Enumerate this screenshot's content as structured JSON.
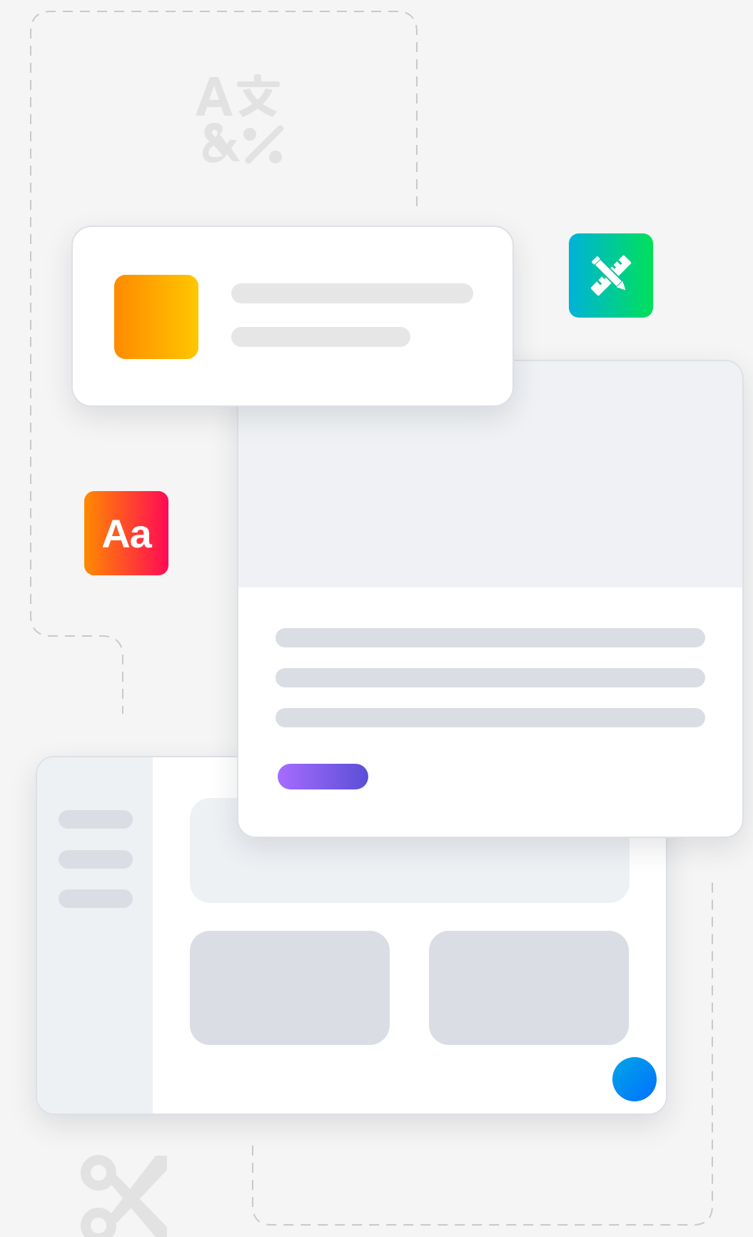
{
  "illustration": {
    "type_icon": {
      "label": "Aa",
      "gradient": [
        "#ff8a00",
        "#ff0a55"
      ]
    },
    "tools_icon": {
      "icon": "ruler-pencil-icon",
      "gradient": [
        "#00b2d9",
        "#00e05a"
      ]
    },
    "list_card": {
      "thumbnail_gradient": [
        "#ff8a00",
        "#ffc700"
      ],
      "placeholder_lines": 2
    },
    "article_card": {
      "placeholder_lines": 3,
      "button_gradient": [
        "#a66cff",
        "#5b4fd6"
      ]
    },
    "dashboard_card": {
      "sidebar_lines": 3,
      "tiles": 2,
      "dot_gradient": [
        "#00a6e6",
        "#0070ff"
      ]
    },
    "decorations": [
      "translate-glyphs-icon",
      "scissors-icon"
    ]
  }
}
